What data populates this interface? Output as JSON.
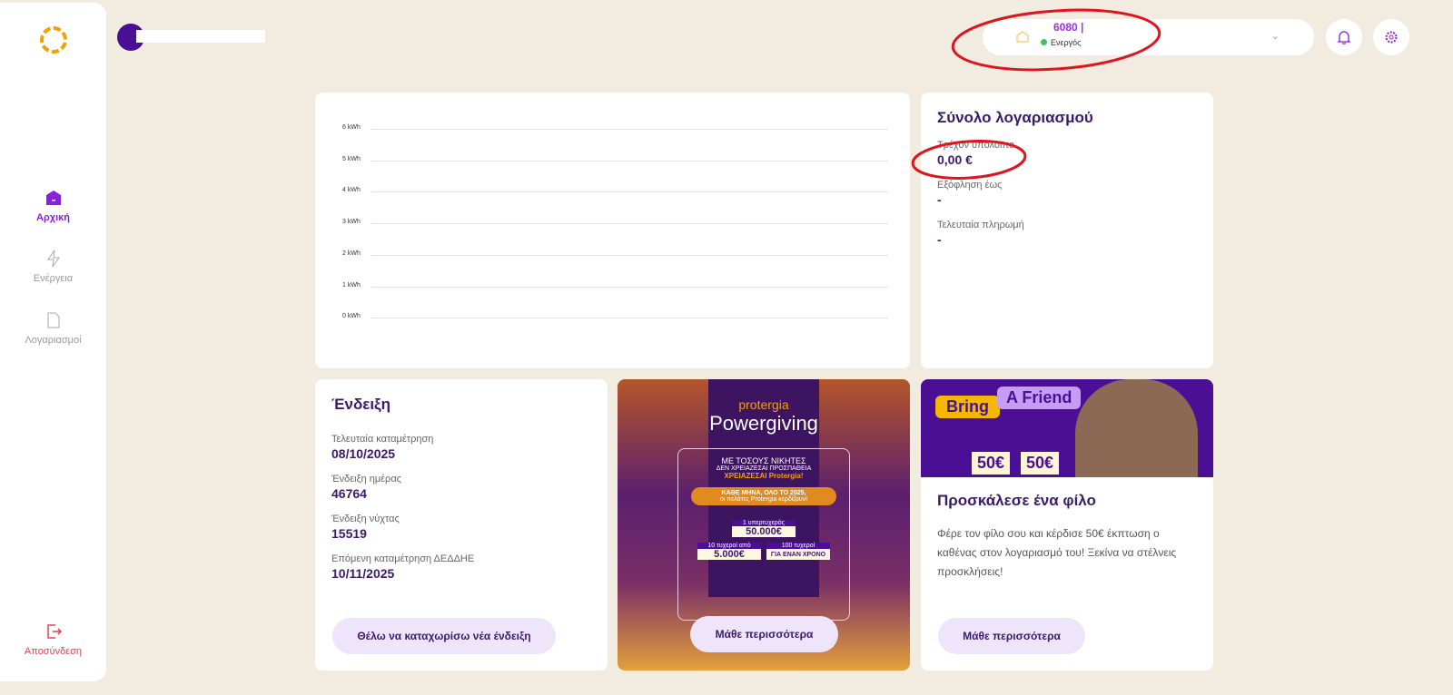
{
  "sidebar": {
    "items": [
      {
        "label": "Αρχική",
        "icon": "home-icon",
        "active": true
      },
      {
        "label": "Ενέργεια",
        "icon": "lightning-icon"
      },
      {
        "label": "Λογαριασμοί",
        "icon": "document-icon"
      }
    ],
    "logout": "Αποσύνδεση"
  },
  "header": {
    "account_number": "6080 |",
    "status": "Ενεργός",
    "status_color": "#3cc45a"
  },
  "chart_data": {
    "type": "line",
    "yticks": [
      "6 kWh",
      "5 kWh",
      "4 kWh",
      "3 kWh",
      "2 kWh",
      "1 kWh",
      "0 kWh"
    ],
    "ylim": [
      0,
      6
    ],
    "series": [],
    "grid": true
  },
  "account": {
    "title": "Σύνολο λογαριασμού",
    "balance_label": "Τρέχον υπόλοιπο",
    "balance": "0,00 €",
    "due_label": "Εξόφληση έως",
    "due": "-",
    "last_payment_label": "Τελευταία πληρωμή",
    "last_payment": "-"
  },
  "reading": {
    "title": "Ένδειξη",
    "last_label": "Τελευταία καταμέτρηση",
    "last": "08/10/2025",
    "day_label": "Ένδειξη ημέρας",
    "day": "46764",
    "night_label": "Ένδειξη νύχτας",
    "night": "15519",
    "next_label": "Επόμενη καταμέτρηση ΔΕΔΔΗΕ",
    "next": "10/11/2025",
    "button": "Θέλω να καταχωρίσω νέα ένδειξη"
  },
  "promo": {
    "brand": "protergia",
    "title": "Powergiving",
    "line1": "ΜΕ ΤΟΣΟΥΣ ΝΙΚΗΤΕΣ",
    "line2": "ΔΕΝ ΧΡΕΙΑΖΕΣΑΙ ΠΡΟΣΠΑΘΕΙΑ",
    "line3": "ΧΡΕΙΑΖΕΣΑΙ Protergia!",
    "line4": "ΚΑΘΕ ΜΗΝΑ, ΟΛΟ ΤΟ 2025,",
    "line5": "οι πελάτες Protergia κερδίζουν!",
    "prize1": "1 υπερτυχερός",
    "prize1_amount": "50.000€",
    "prize2": "10 τυχεροί από",
    "prize2_amount": "5.000€",
    "prize3": "100 τυχεροί",
    "prize3_amount": "ΓΙΑ ΕΝΑΝ ΧΡΟΝΟ",
    "button": "Μάθε περισσότερα"
  },
  "referral": {
    "bring": "Bring",
    "friend": "A Friend",
    "amount1": "50€",
    "amount2": "50€",
    "title": "Προσκάλεσε ένα φίλο",
    "text": "Φέρε τον φίλο σου και κέρδισε 50€ έκπτωση ο καθένας στον λογαριασμό του! Ξεκίνα να στέλνεις προσκλήσεις!",
    "button": "Μάθε περισσότερα"
  }
}
